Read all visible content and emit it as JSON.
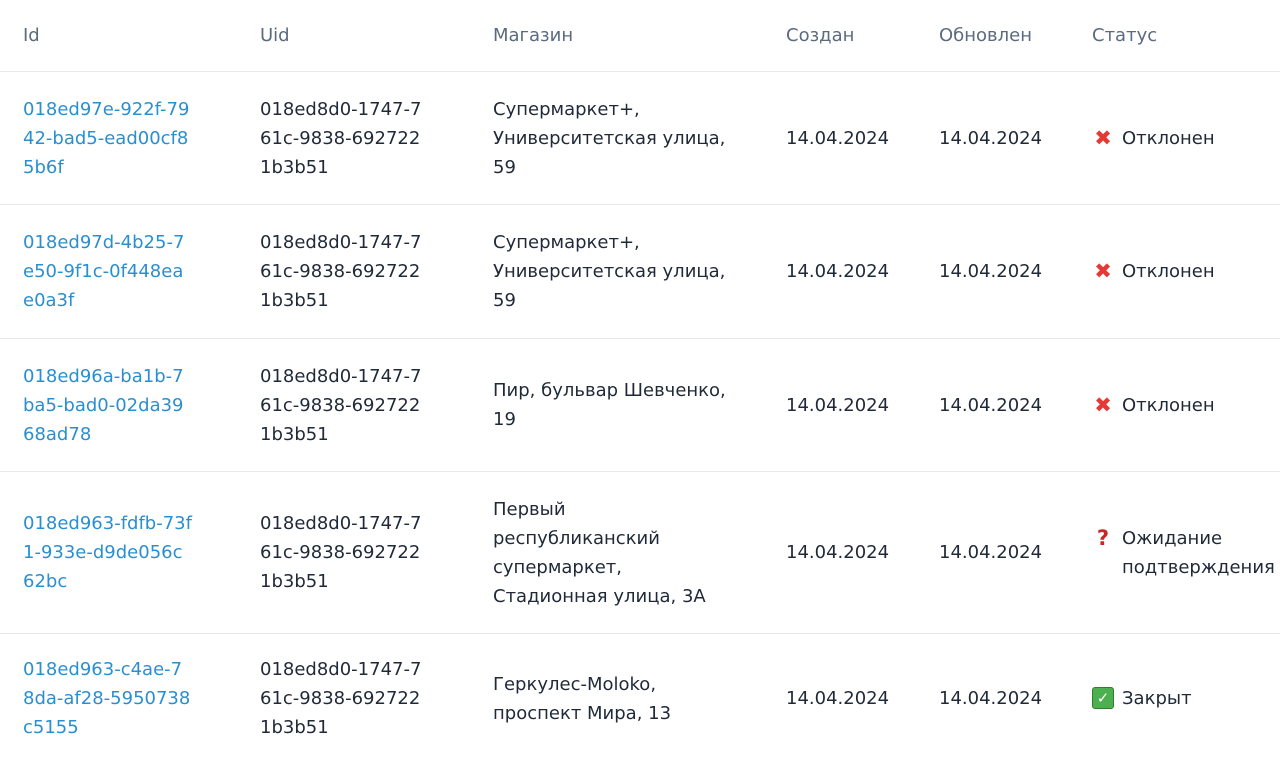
{
  "table": {
    "headers": {
      "id": "Id",
      "uid": "Uid",
      "shop": "Магазин",
      "created": "Создан",
      "updated": "Обновлен",
      "status": "Статус"
    },
    "rows": [
      {
        "id": "018ed97e-922f-7942-bad5-ead00cf85b6f",
        "uid": "018ed8d0-1747-761c-9838-6927221b3b51",
        "shop": "Супермаркет+, Университетская улица, 59",
        "created": "14.04.2024",
        "updated": "14.04.2024",
        "status_icon": "cross-mark-icon",
        "status": "Отклонен"
      },
      {
        "id": "018ed97d-4b25-7e50-9f1c-0f448eae0a3f",
        "uid": "018ed8d0-1747-761c-9838-6927221b3b51",
        "shop": "Супермаркет+, Университетская улица, 59",
        "created": "14.04.2024",
        "updated": "14.04.2024",
        "status_icon": "cross-mark-icon",
        "status": "Отклонен"
      },
      {
        "id": "018ed96a-ba1b-7ba5-bad0-02da3968ad78",
        "uid": "018ed8d0-1747-761c-9838-6927221b3b51",
        "shop": "Пир, бульвар Шевченко, 19",
        "created": "14.04.2024",
        "updated": "14.04.2024",
        "status_icon": "cross-mark-icon",
        "status": "Отклонен"
      },
      {
        "id": "018ed963-fdfb-73f1-933e-d9de056c62bc",
        "uid": "018ed8d0-1747-761c-9838-6927221b3b51",
        "shop": "Первый республиканский супермаркет, Стадионная улица, 3А",
        "created": "14.04.2024",
        "updated": "14.04.2024",
        "status_icon": "question-mark-icon",
        "status": "Ожидание подтверждения"
      },
      {
        "id": "018ed963-c4ae-78da-af28-5950738c5155",
        "uid": "018ed8d0-1747-761c-9838-6927221b3b51",
        "shop": "Геркулес-Moloko, проспект Мира, 13",
        "created": "14.04.2024",
        "updated": "14.04.2024",
        "status_icon": "check-mark-icon",
        "status": "Закрыт"
      }
    ]
  },
  "colors": {
    "link": "#2a8fd0",
    "header_text": "#5b6b7f",
    "body_text": "#1f2937",
    "divider": "#e6e8eb",
    "rejected_icon": "#e53935",
    "pending_icon": "#c62828",
    "closed_icon": "#4caf50"
  }
}
